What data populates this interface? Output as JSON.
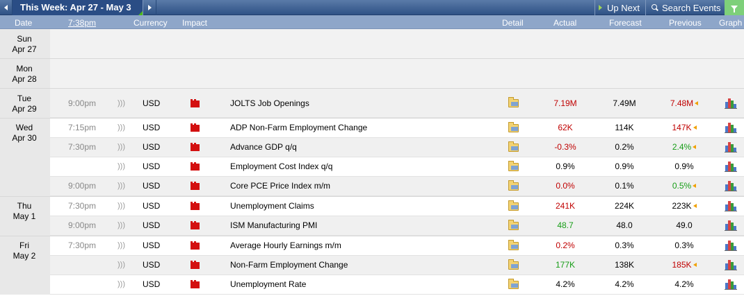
{
  "toolbar": {
    "week_label": "This Week: Apr 27 - May 3",
    "up_next_label": "Up Next",
    "search_label": "Search Events"
  },
  "header": {
    "date": "Date",
    "time": "7:38pm",
    "currency": "Currency",
    "impact": "Impact",
    "detail": "Detail",
    "actual": "Actual",
    "forecast": "Forecast",
    "previous": "Previous",
    "graph": "Graph"
  },
  "colors": {
    "better": "#169d16",
    "worse": "#c00000",
    "high_impact": "#d31010",
    "revised": "#f0a000"
  },
  "days": [
    {
      "dow": "Sun",
      "date": "Apr 27"
    },
    {
      "dow": "Mon",
      "date": "Apr 28"
    },
    {
      "dow": "Tue",
      "date": "Apr 29"
    },
    {
      "dow": "Wed",
      "date": "Apr 30"
    },
    {
      "dow": "Thu",
      "date": "May 1"
    },
    {
      "dow": "Fri",
      "date": "May 2"
    }
  ],
  "events": [
    {
      "time": "9:00pm",
      "currency": "USD",
      "name": "JOLTS Job Openings",
      "actual": "7.19M",
      "forecast": "7.49M",
      "previous": "7.48M"
    },
    {
      "time": "7:15pm",
      "currency": "USD",
      "name": "ADP Non-Farm Employment Change",
      "actual": "62K",
      "forecast": "114K",
      "previous": "147K"
    },
    {
      "time": "7:30pm",
      "currency": "USD",
      "name": "Advance GDP q/q",
      "actual": "-0.3%",
      "forecast": "0.2%",
      "previous": "2.4%"
    },
    {
      "time": "",
      "currency": "USD",
      "name": "Employment Cost Index q/q",
      "actual": "0.9%",
      "forecast": "0.9%",
      "previous": "0.9%"
    },
    {
      "time": "9:00pm",
      "currency": "USD",
      "name": "Core PCE Price Index m/m",
      "actual": "0.0%",
      "forecast": "0.1%",
      "previous": "0.5%"
    },
    {
      "time": "7:30pm",
      "currency": "USD",
      "name": "Unemployment Claims",
      "actual": "241K",
      "forecast": "224K",
      "previous": "223K"
    },
    {
      "time": "9:00pm",
      "currency": "USD",
      "name": "ISM Manufacturing PMI",
      "actual": "48.7",
      "forecast": "48.0",
      "previous": "49.0"
    },
    {
      "time": "7:30pm",
      "currency": "USD",
      "name": "Average Hourly Earnings m/m",
      "actual": "0.2%",
      "forecast": "0.3%",
      "previous": "0.3%"
    },
    {
      "time": "",
      "currency": "USD",
      "name": "Non-Farm Employment Change",
      "actual": "177K",
      "forecast": "138K",
      "previous": "185K"
    },
    {
      "time": "",
      "currency": "USD",
      "name": "Unemployment Rate",
      "actual": "4.2%",
      "forecast": "4.2%",
      "previous": "4.2%"
    }
  ]
}
